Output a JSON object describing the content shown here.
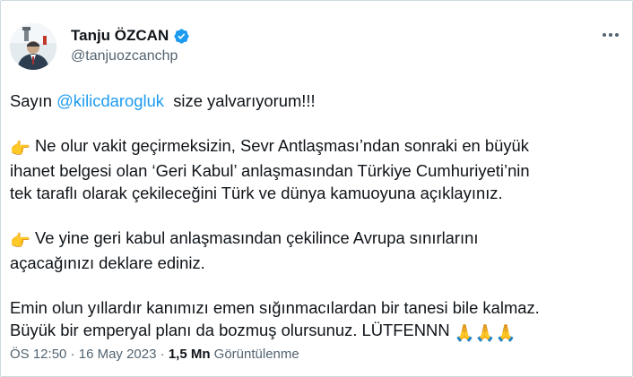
{
  "tweet": {
    "author": {
      "display_name": "Tanju ÖZCAN",
      "handle": "@tanjuozcanchp",
      "verified": true
    },
    "more_icon": "more-horizontal-icon",
    "paragraphs": {
      "p1": {
        "prefix": "Sayın ",
        "mention": "@kilicdarogluk",
        "suffix": "  size yalvarıyorum!!!"
      },
      "p2": {
        "emoji": "👉",
        "lines": [
          " Ne olur vakit geçirmeksizin, Sevr Antlaşması’ndan sonraki en büyük",
          "ihanet belgesi olan ‘Geri Kabul’ anlaşmasından Türkiye Cumhuriyeti’nin",
          "tek taraflı olarak çekileceğini Türk ve dünya kamuoyuna açıklayınız."
        ]
      },
      "p3": {
        "emoji": "👉",
        "lines": [
          " Ve yine geri kabul anlaşmasından çekilince Avrupa sınırlarını",
          "açacağınızı deklare ediniz."
        ]
      },
      "p4": {
        "lines": [
          "Emin olun yıllardır kanımızı emen sığınmacılardan bir tanesi bile kalmaz.",
          "Büyük bir emperyal planı da bozmuş olursunuz. LÜTFENNN "
        ],
        "emojis": "🙏🙏🙏"
      }
    },
    "meta": {
      "time": "ÖS 12:50",
      "separator": " · ",
      "date": "16 May 2023",
      "views_count": "1,5 Mn",
      "views_label": " Görüntülenme"
    },
    "colors": {
      "accent": "#1d9bf0",
      "text": "#0f1419",
      "secondary": "#536471"
    }
  }
}
